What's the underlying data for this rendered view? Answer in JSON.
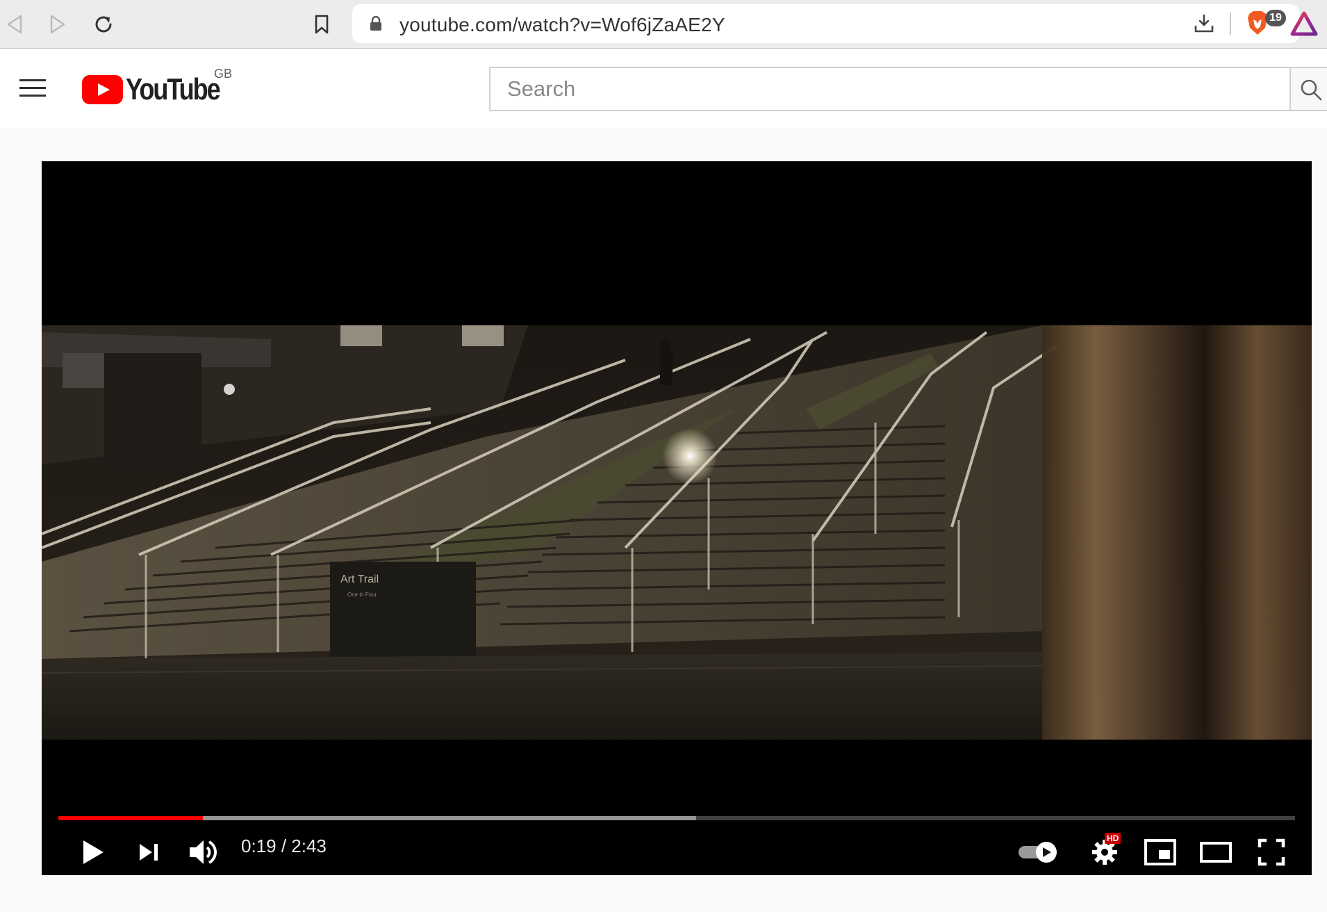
{
  "browser": {
    "url": "youtube.com/watch?v=Wof6jZaAE2Y",
    "shields_count": "19",
    "icons": [
      "back-icon",
      "forward-icon",
      "reload-icon",
      "bookmark-icon",
      "lock-icon",
      "download-icon",
      "brave-lion-icon",
      "brave-rewards-icon"
    ]
  },
  "header": {
    "logo_text": "YouTube",
    "region": "GB",
    "search_placeholder": "Search",
    "icons": [
      "hamburger-menu-icon",
      "youtube-play-logo-icon",
      "search-icon"
    ]
  },
  "player": {
    "current_time": "0:19",
    "separator": " / ",
    "duration": "2:43",
    "progress_played_fraction": 0.117,
    "progress_buffered_fraction": 0.516,
    "autoplay_on": true,
    "quality_badge": "HD",
    "video_sign_title": "Art Trail",
    "video_sign_subtitle": "One in Four",
    "icons": [
      "play-icon",
      "next-icon",
      "volume-icon",
      "autoplay-toggle-icon",
      "settings-gear-icon",
      "miniplayer-icon",
      "theater-mode-icon",
      "fullscreen-icon"
    ],
    "colors": {
      "progress_played": "#ff0000",
      "badge": "#cc0000",
      "logo_red": "#ff0000"
    }
  }
}
